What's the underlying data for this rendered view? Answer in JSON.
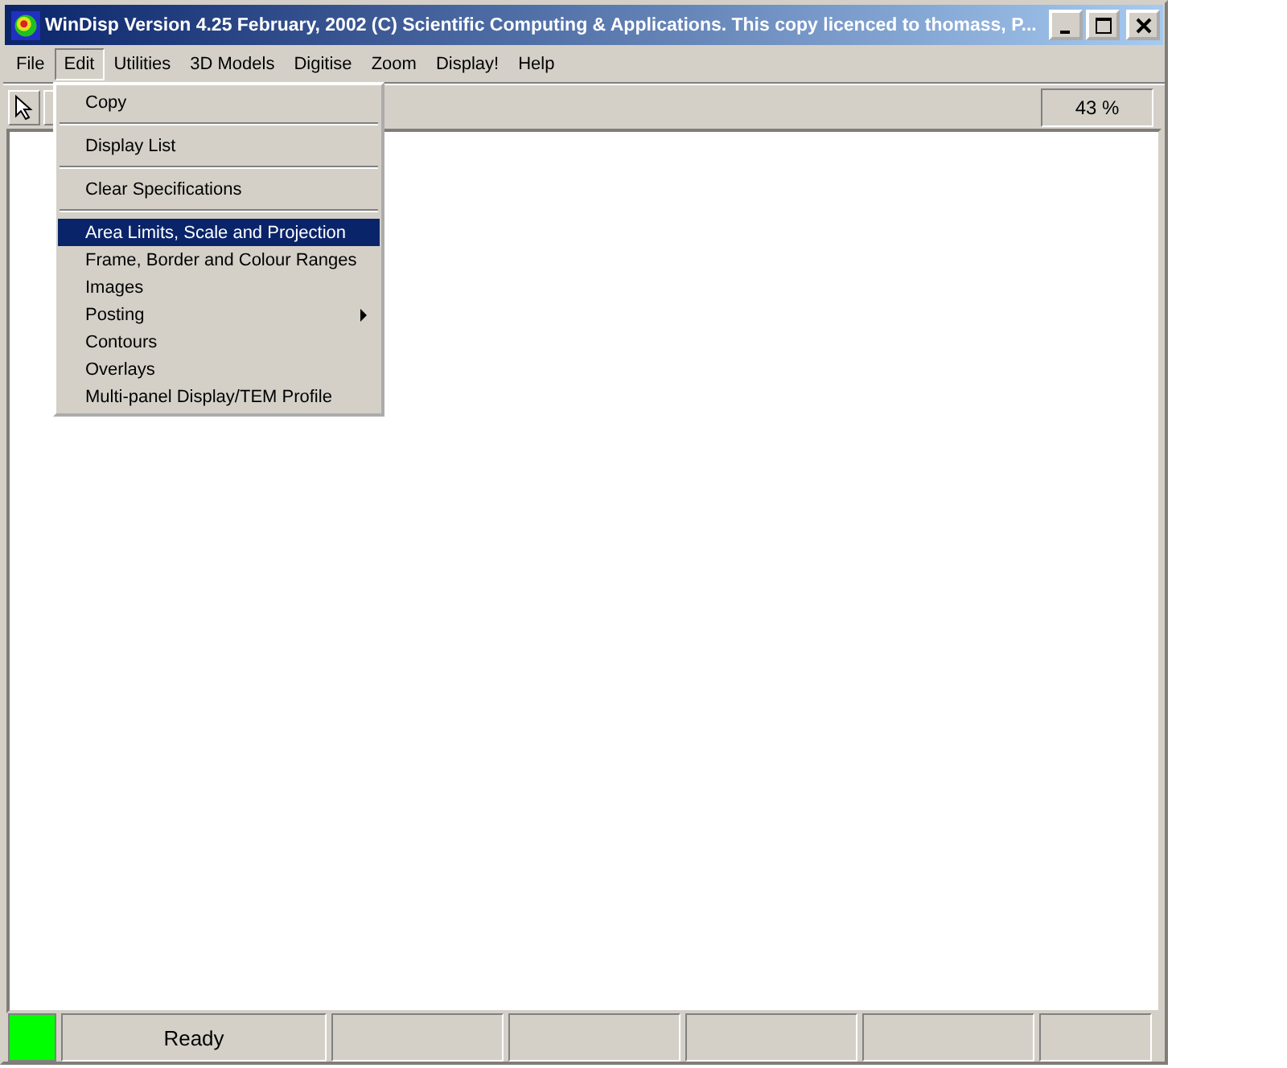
{
  "window": {
    "title": "WinDisp Version 4.25 February, 2002 (C) Scientific Computing & Applications. This copy licenced to thomass, P..."
  },
  "menu_bar": [
    {
      "label": "File",
      "selected": false
    },
    {
      "label": "Edit",
      "selected": true
    },
    {
      "label": "Utilities",
      "selected": false
    },
    {
      "label": "3D Models",
      "selected": false
    },
    {
      "label": "Digitise",
      "selected": false
    },
    {
      "label": "Zoom",
      "selected": false
    },
    {
      "label": "Display!",
      "selected": false
    },
    {
      "label": "Help",
      "selected": false
    }
  ],
  "edit_menu": [
    {
      "kind": "item",
      "label": "Copy",
      "selected": false
    },
    {
      "kind": "separator"
    },
    {
      "kind": "item",
      "label": "Display List",
      "selected": false
    },
    {
      "kind": "separator"
    },
    {
      "kind": "item",
      "label": "Clear Specifications",
      "selected": false
    },
    {
      "kind": "separator"
    },
    {
      "kind": "item",
      "label": "Area Limits, Scale and Projection",
      "selected": true
    },
    {
      "kind": "item",
      "label": "Frame, Border and Colour Ranges",
      "selected": false
    },
    {
      "kind": "item",
      "label": "Images",
      "selected": false
    },
    {
      "kind": "submenu",
      "label": "Posting",
      "selected": false
    },
    {
      "kind": "item",
      "label": "Contours",
      "selected": false
    },
    {
      "kind": "item",
      "label": "Overlays",
      "selected": false
    },
    {
      "kind": "item",
      "label": "Multi-panel Display/TEM Profile",
      "selected": false
    }
  ],
  "toolbar": {
    "zoom_level": "43 %"
  },
  "status_bar": {
    "panels": [
      "Ready"
    ]
  }
}
